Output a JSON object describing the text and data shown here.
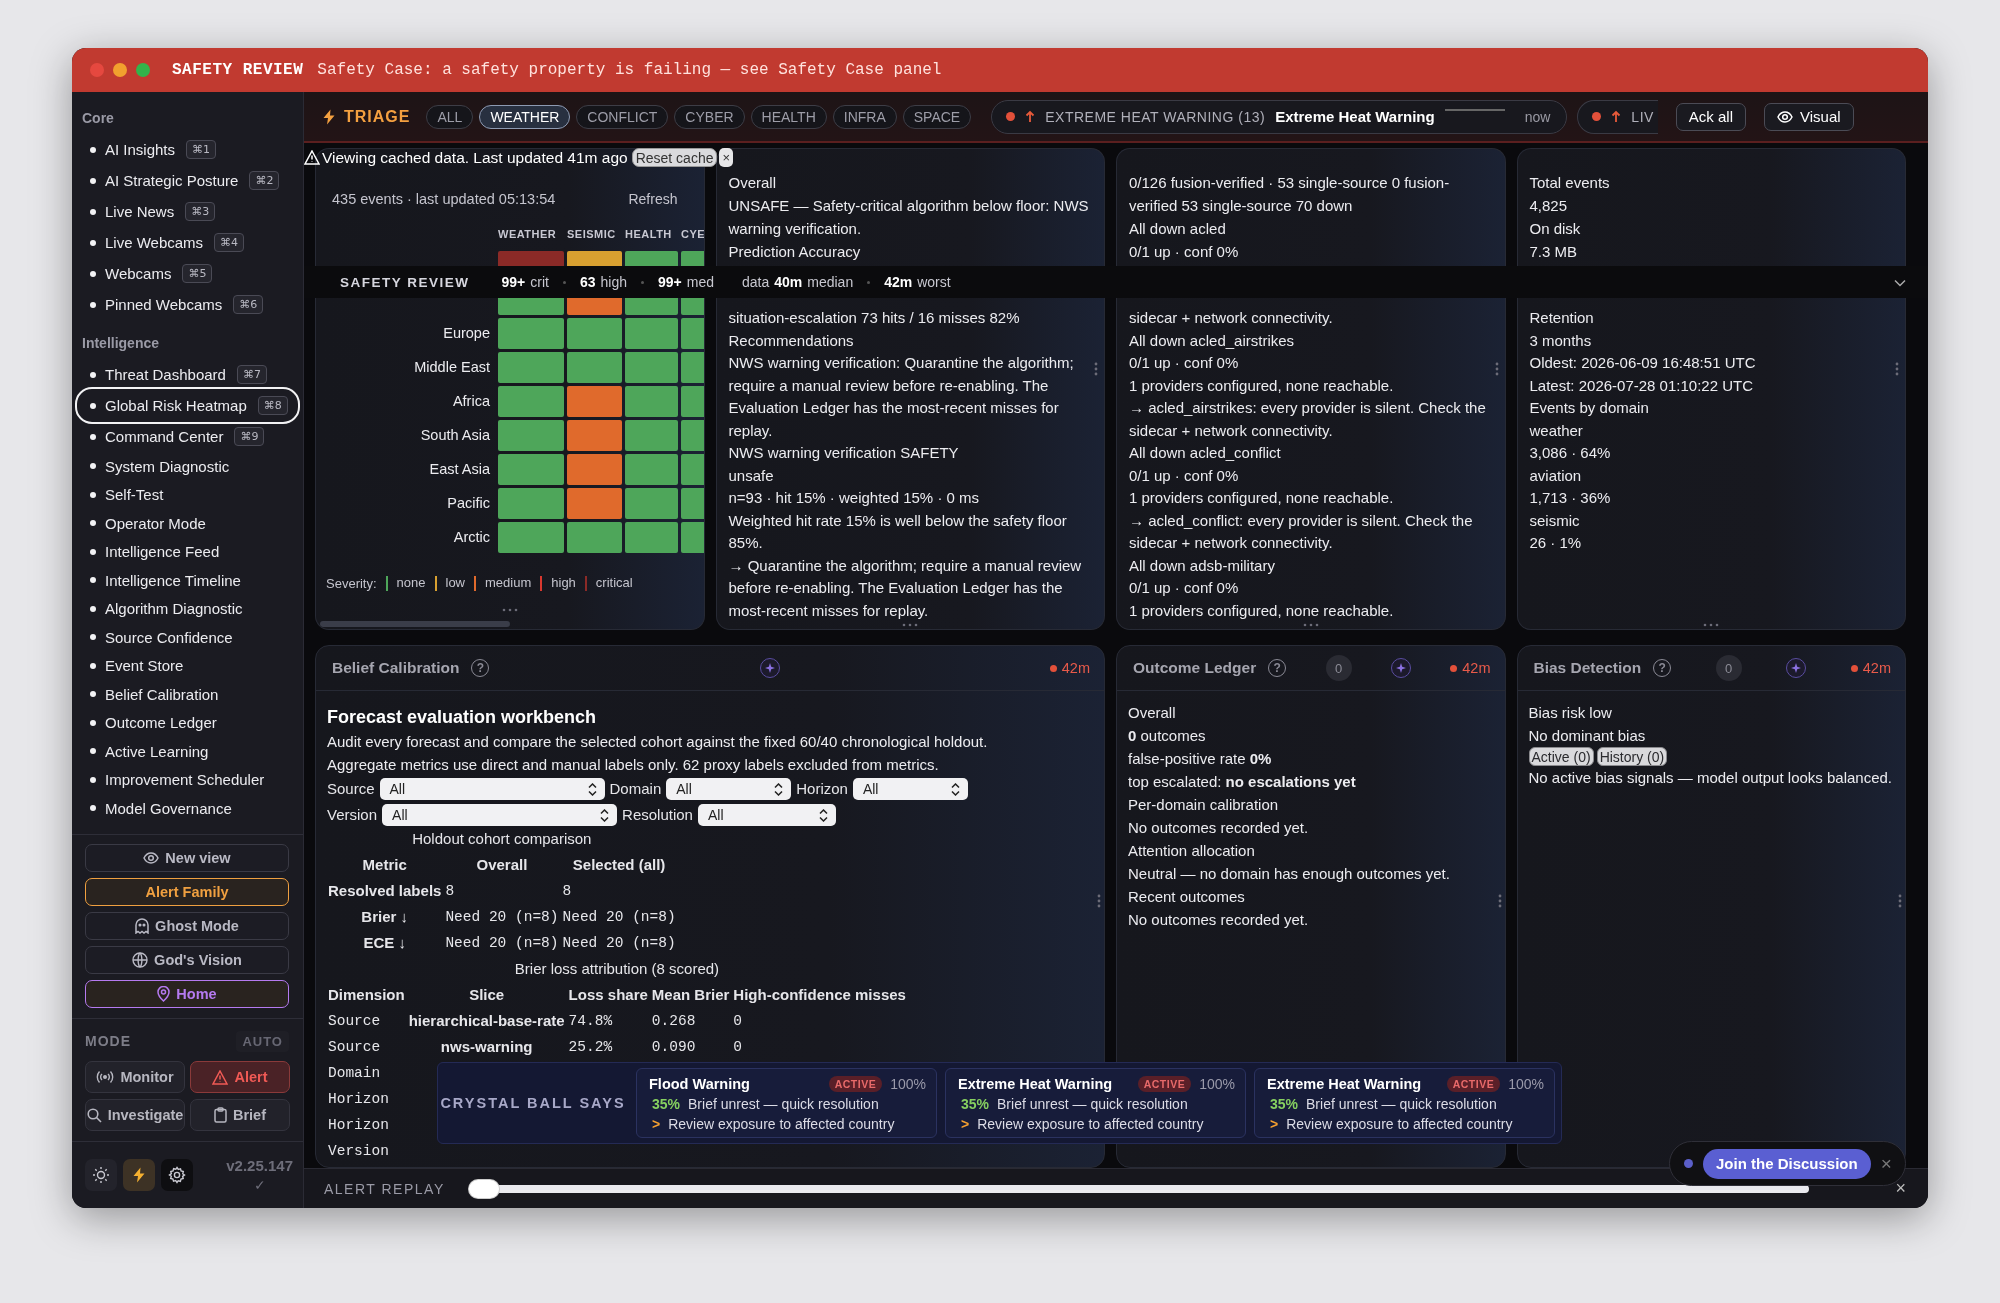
{
  "window": {
    "title": "SAFETY REVIEW",
    "banner": "Safety Case: a safety property is failing — see Safety Case panel"
  },
  "sidebar": {
    "sections": [
      {
        "heading": "Core",
        "items": [
          {
            "label": "AI Insights",
            "shortcut": "⌘1",
            "selected": false
          },
          {
            "label": "AI Strategic Posture",
            "shortcut": "⌘2",
            "selected": false
          },
          {
            "label": "Live News",
            "shortcut": "⌘3",
            "selected": false
          },
          {
            "label": "Live Webcams",
            "shortcut": "⌘4",
            "selected": false
          },
          {
            "label": "Webcams",
            "shortcut": "⌘5",
            "selected": false
          },
          {
            "label": "Pinned Webcams",
            "shortcut": "⌘6",
            "selected": false
          }
        ]
      },
      {
        "heading": "Intelligence",
        "items": [
          {
            "label": "Threat Dashboard",
            "shortcut": "⌘7",
            "selected": false
          },
          {
            "label": "Global Risk Heatmap",
            "shortcut": "⌘8",
            "selected": true
          },
          {
            "label": "Command Center",
            "shortcut": "⌘9",
            "selected": false
          },
          {
            "label": "System Diagnostic",
            "selected": false
          },
          {
            "label": "Self-Test",
            "selected": false
          },
          {
            "label": "Operator Mode",
            "selected": false
          },
          {
            "label": "Intelligence Feed",
            "selected": false
          },
          {
            "label": "Intelligence Timeline",
            "selected": false
          },
          {
            "label": "Algorithm Diagnostic",
            "selected": false
          },
          {
            "label": "Source Confidence",
            "selected": false
          },
          {
            "label": "Event Store",
            "selected": false
          },
          {
            "label": "Belief Calibration",
            "selected": false
          },
          {
            "label": "Outcome Ledger",
            "selected": false
          },
          {
            "label": "Active Learning",
            "selected": false
          },
          {
            "label": "Improvement Scheduler",
            "selected": false
          },
          {
            "label": "Model Governance",
            "selected": false
          }
        ]
      }
    ],
    "view_buttons": [
      {
        "label": "New view"
      },
      {
        "label": "Alert Family",
        "color": "#f0a040"
      },
      {
        "label": "Ghost Mode"
      },
      {
        "label": "God's Vision"
      },
      {
        "label": "Home",
        "color": "#b57af0"
      }
    ],
    "mode": {
      "heading": "MODE",
      "auto": {
        "label": "AUTO",
        "disabled": true
      },
      "options": [
        {
          "label": "Monitor",
          "selected": false
        },
        {
          "label": "Alert",
          "selected": true
        },
        {
          "label": "Investigate",
          "selected": false
        },
        {
          "label": "Brief",
          "selected": false
        }
      ]
    },
    "quick_actions": [
      {
        "selected": false
      },
      {
        "selected": true
      },
      {
        "selected": false
      }
    ],
    "version": "v2.25.147",
    "status": "✓"
  },
  "triage": {
    "title": "TRIAGE",
    "filters": [
      {
        "label": "ALL",
        "selected": false
      },
      {
        "label": "WEATHER",
        "selected": true
      },
      {
        "label": "CONFLICT",
        "selected": false
      },
      {
        "label": "CYBER",
        "selected": false
      },
      {
        "label": "HEALTH",
        "selected": false
      },
      {
        "label": "INFRA",
        "selected": false
      },
      {
        "label": "SPACE",
        "selected": false
      }
    ],
    "alerts": [
      {
        "title": "EXTREME HEAT WARNING (13)",
        "detail": "Extreme Heat Warning",
        "time": "now"
      },
      {
        "title": "LIV"
      }
    ],
    "actions": [
      {
        "label": "Ack all"
      },
      {
        "label": "Visual"
      }
    ]
  },
  "cache_notice": {
    "text": "Viewing cached data. Last updated 41m ago",
    "reset": "Reset cache",
    "close": "×"
  },
  "safety_strip": {
    "title": "SAFETY REVIEW",
    "counts": [
      {
        "value": "99+",
        "label": "crit"
      },
      {
        "value": "63",
        "label": "high"
      },
      {
        "value": "99+",
        "label": "med"
      }
    ],
    "latency_label": "data",
    "latency": [
      {
        "value": "40m",
        "label": "median"
      },
      {
        "value": "42m",
        "label": "worst"
      }
    ]
  },
  "top_panels": [
    {
      "kind": "heatmap",
      "summary": "435 events · last updated 05:13:54",
      "refresh": "Refresh",
      "columns": [
        "WEATHER",
        "SEISMIC",
        "HEALTH",
        "CYE"
      ],
      "rows_above_strip": [
        {
          "cells": [
            {
              "color": "#8b2a27"
            },
            {
              "color": "#d8a030"
            },
            {
              "color": "#4ea65a"
            },
            {
              "color": "#4ea65a"
            }
          ]
        }
      ],
      "rows_below_strip": [
        {
          "cells": [
            {
              "color": "#4ea65a"
            },
            {
              "color": "#e06a2c"
            },
            {
              "color": "#4ea65a"
            },
            {
              "color": "#4ea65a"
            }
          ]
        },
        {
          "label": "Europe",
          "cells": [
            {
              "color": "#4ea65a"
            },
            {
              "color": "#4ea65a"
            },
            {
              "color": "#4ea65a"
            },
            {
              "color": "#4ea65a"
            }
          ]
        },
        {
          "label": "Middle East",
          "cells": [
            {
              "color": "#4ea65a"
            },
            {
              "color": "#4ea65a"
            },
            {
              "color": "#4ea65a"
            },
            {
              "color": "#4ea65a"
            }
          ]
        },
        {
          "label": "Africa",
          "cells": [
            {
              "color": "#4ea65a"
            },
            {
              "color": "#e06a2c"
            },
            {
              "color": "#4ea65a"
            },
            {
              "color": "#4ea65a"
            }
          ]
        },
        {
          "label": "South Asia",
          "cells": [
            {
              "color": "#4ea65a"
            },
            {
              "color": "#e06a2c"
            },
            {
              "color": "#4ea65a"
            },
            {
              "color": "#4ea65a"
            }
          ]
        },
        {
          "label": "East Asia",
          "cells": [
            {
              "color": "#4ea65a"
            },
            {
              "color": "#e06a2c"
            },
            {
              "color": "#4ea65a"
            },
            {
              "color": "#4ea65a"
            }
          ]
        },
        {
          "label": "Pacific",
          "cells": [
            {
              "color": "#4ea65a"
            },
            {
              "color": "#e06a2c"
            },
            {
              "color": "#4ea65a"
            },
            {
              "color": "#4ea65a"
            }
          ]
        },
        {
          "label": "Arctic",
          "cells": [
            {
              "color": "#4ea65a"
            },
            {
              "color": "#4ea65a"
            },
            {
              "color": "#4ea65a"
            },
            {
              "color": "#4ea65a"
            }
          ]
        }
      ],
      "legend": {
        "label": "Severity:",
        "levels": [
          {
            "label": "none",
            "color": "#4ea65a"
          },
          {
            "label": "low",
            "color": "#d8a030"
          },
          {
            "label": "medium",
            "color": "#e06a2c"
          },
          {
            "label": "high",
            "color": "#d9382f"
          },
          {
            "label": "critical",
            "color": "#8b2a27"
          }
        ]
      }
    },
    {
      "kind": "text",
      "lines_above_strip": [
        "Overall",
        "UNSAFE — Safety-critical algorithm below floor: NWS warning verification.",
        "Prediction Accuracy"
      ],
      "lines_below_strip": [
        "situation-escalation 73 hits / 16 misses 82%",
        "Recommendations",
        "NWS warning verification: Quarantine the algorithm; require a manual review before re-enabling. The Evaluation Ledger has the most-recent misses for replay.",
        "NWS warning verification SAFETY",
        "unsafe",
        "n=93 · hit 15% · weighted 15% · 0 ms",
        "Weighted hit rate 15% is well below the safety floor 85%.",
        "→ Quarantine the algorithm; require a manual review before re-enabling. The Evaluation Ledger has the most-recent misses for replay."
      ]
    },
    {
      "kind": "text",
      "lines_above_strip": [
        "0/126 fusion-verified · 53 single-source 0 fusion-verified 53 single-source 70 down",
        "All down acled",
        "0/1 up · conf 0%"
      ],
      "lines_below_strip": [
        "sidecar + network connectivity.",
        "All down acled_airstrikes",
        "0/1 up · conf 0%",
        "1 providers configured, none reachable.",
        "→ acled_airstrikes: every provider is silent. Check the sidecar + network connectivity.",
        "All down acled_conflict",
        "0/1 up · conf 0%",
        "1 providers configured, none reachable.",
        "→ acled_conflict: every provider is silent. Check the sidecar + network connectivity.",
        "All down adsb-military",
        "0/1 up · conf 0%",
        "1 providers configured, none reachable."
      ]
    },
    {
      "kind": "text",
      "lines_above_strip": [
        "Total events",
        "4,825",
        "On disk",
        "7.3 MB"
      ],
      "lines_below_strip": [
        "Retention",
        "3 months",
        "Oldest: 2026-06-09 16:48:51 UTC",
        "Latest: 2026-07-28 01:10:22 UTC",
        "Events by domain",
        "weather",
        "3,086 · 64%",
        "aviation",
        "1,713 · 36%",
        "seismic",
        "26 · 1%"
      ]
    }
  ],
  "bottom_panels": [
    {
      "kind": "workbench",
      "title": "Belief Calibration",
      "help": "?",
      "age": "42m",
      "heading": "Forecast evaluation workbench",
      "description": [
        "Audit every forecast and compare the selected cohort against the fixed 60/40 chronological holdout.",
        "Aggregate metrics use direct and manual labels only. 62 proxy labels excluded from metrics."
      ],
      "filters": [
        {
          "label": "Source",
          "value": "All"
        },
        {
          "label": "Domain",
          "value": "All"
        },
        {
          "label": "Horizon",
          "value": "All"
        },
        {
          "label": "Version",
          "value": "All"
        },
        {
          "label": "Resolution",
          "value": "All"
        }
      ],
      "comparison": {
        "caption": "Holdout cohort comparison",
        "columns": [
          "Metric",
          "Overall",
          "Selected (all)"
        ],
        "rows": [
          [
            "Resolved labels",
            "8",
            "8"
          ],
          [
            "Brier ↓",
            "Need 20 (n=8)",
            "Need 20 (n=8)"
          ],
          [
            "ECE ↓",
            "Need 20 (n=8)",
            "Need 20 (n=8)"
          ]
        ]
      },
      "attribution": {
        "caption": "Brier loss attribution (8 scored)",
        "columns": [
          "Dimension",
          "Slice",
          "Loss share",
          "Mean Brier",
          "High-confidence misses"
        ],
        "rows": [
          [
            "Source",
            "hierarchical-base-rate",
            "74.8%",
            "0.268",
            "0"
          ],
          [
            "Source",
            "nws-warning",
            "25.2%",
            "0.090",
            "0"
          ],
          [
            "Domain"
          ],
          [
            "Horizon"
          ],
          [
            "Horizon"
          ],
          [
            "Version"
          ]
        ]
      }
    },
    {
      "kind": "lines",
      "title": "Outcome Ledger",
      "help": "?",
      "count": "0",
      "age": "42m",
      "lines": [
        "Overall",
        "**0** outcomes",
        "false-positive rate **0%**",
        "top escalated: **no escalations yet**",
        "Per-domain calibration",
        "No outcomes recorded yet.",
        "Attention allocation",
        "Neutral — no domain has enough outcomes yet.",
        "Recent outcomes",
        "No outcomes recorded yet."
      ]
    },
    {
      "kind": "bias",
      "title": "Bias Detection",
      "help": "?",
      "count": "0",
      "age": "42m",
      "lines": [
        "Bias risk low",
        "No dominant bias"
      ],
      "tabs": [
        "Active (0)",
        "History (0)"
      ],
      "note": "No active bias signals — model output looks balanced."
    }
  ],
  "crystal_ball": {
    "title": "CRYSTAL BALL SAYS",
    "cards": [
      {
        "title": "Flood Warning",
        "status": "ACTIVE",
        "confidence": "100%",
        "probability": "35%",
        "outlook": "Brief unrest — quick resolution",
        "marker": ">",
        "action": "Review exposure to affected country"
      },
      {
        "title": "Extreme Heat Warning",
        "status": "ACTIVE",
        "confidence": "100%",
        "probability": "35%",
        "outlook": "Brief unrest — quick resolution",
        "marker": ">",
        "action": "Review exposure to affected country"
      },
      {
        "title": "Extreme Heat Warning",
        "status": "ACTIVE",
        "confidence": "100%",
        "probability": "35%",
        "outlook": "Brief unrest — quick resolution",
        "marker": ">",
        "action": "Review exposure to affected country"
      }
    ]
  },
  "discussion": {
    "button": "Join the Discussion",
    "close": "×"
  },
  "replay": {
    "label": "ALERT REPLAY",
    "level": 0,
    "close": "×"
  }
}
